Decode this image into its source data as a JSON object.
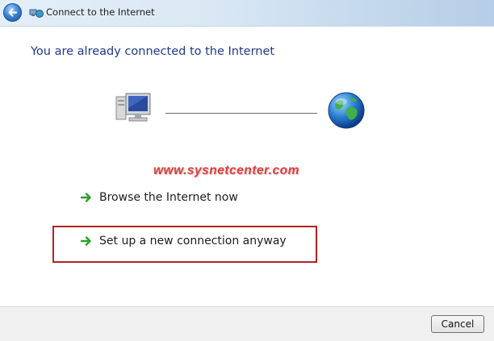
{
  "window": {
    "title": "Connect to the Internet",
    "back_icon": "back-arrow-icon",
    "title_icon": "network-globe-icon"
  },
  "main": {
    "heading": "You are already connected to the Internet",
    "left_icon": "computer-icon",
    "right_icon": "globe-icon",
    "watermark": "www.sysnetcenter.com",
    "tasks": [
      {
        "label": "Browse the Internet now",
        "icon": "green-arrow-icon"
      },
      {
        "label": "Set up a new connection anyway",
        "icon": "green-arrow-icon"
      }
    ]
  },
  "footer": {
    "cancel_label": "Cancel"
  },
  "colors": {
    "heading": "#1e3a8a",
    "watermark": "#e13c3c",
    "highlight": "#b22222",
    "arrow": "#2e9d2e"
  }
}
